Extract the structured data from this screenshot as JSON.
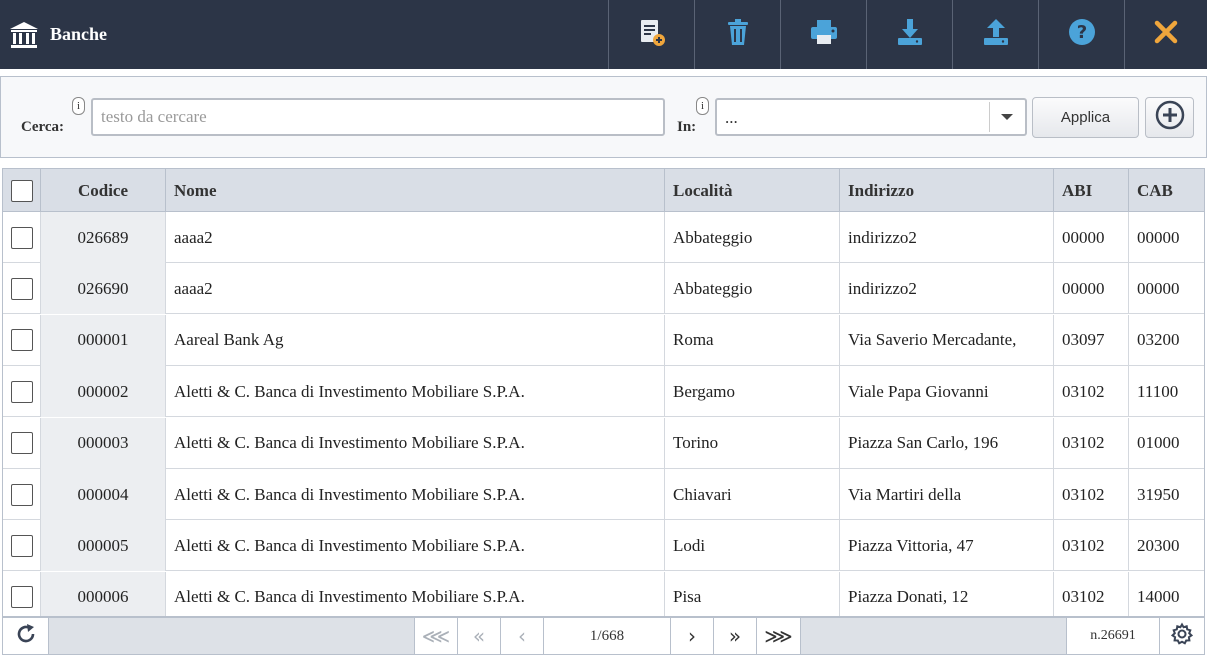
{
  "app": {
    "title": "Banche",
    "title_icon": "bank-icon"
  },
  "toolbar": {
    "buttons": [
      {
        "name": "new-document-button",
        "icon": "new-document-icon"
      },
      {
        "name": "delete-button",
        "icon": "trash-icon"
      },
      {
        "name": "print-button",
        "icon": "printer-icon"
      },
      {
        "name": "download-button",
        "icon": "download-icon"
      },
      {
        "name": "upload-button",
        "icon": "upload-icon"
      },
      {
        "name": "help-button",
        "icon": "help-icon"
      },
      {
        "name": "close-button",
        "icon": "close-icon"
      }
    ],
    "accent_color": "#f0a63c",
    "icon_color": "#4ba3d9",
    "header_bg": "#2c3547"
  },
  "search": {
    "label": "Cerca:",
    "info": "i",
    "placeholder": "testo da cercare",
    "value": "",
    "in_label": "In:",
    "in_info": "i",
    "in_value": "...",
    "apply_label": "Applica"
  },
  "table": {
    "columns": [
      "Codice",
      "Nome",
      "Località",
      "Indirizzo",
      "ABI",
      "CAB"
    ],
    "rows": [
      {
        "codice": "026689",
        "nome": "aaaa2",
        "localita": "Abbateggio",
        "indirizzo": "indirizzo2",
        "abi": "00000",
        "cab": "00000"
      },
      {
        "codice": "026690",
        "nome": "aaaa2",
        "localita": "Abbateggio",
        "indirizzo": "indirizzo2",
        "abi": "00000",
        "cab": "00000"
      },
      {
        "codice": "000001",
        "nome": "Aareal Bank Ag",
        "localita": "Roma",
        "indirizzo": "Via Saverio Mercadante,",
        "abi": "03097",
        "cab": "03200"
      },
      {
        "codice": "000002",
        "nome": "Aletti & C. Banca di Investimento Mobiliare S.P.A.",
        "localita": "Bergamo",
        "indirizzo": "Viale Papa Giovanni",
        "abi": "03102",
        "cab": "11100"
      },
      {
        "codice": "000003",
        "nome": "Aletti & C. Banca di Investimento Mobiliare S.P.A.",
        "localita": "Torino",
        "indirizzo": "Piazza San Carlo, 196",
        "abi": "03102",
        "cab": "01000"
      },
      {
        "codice": "000004",
        "nome": "Aletti & C. Banca di Investimento Mobiliare S.P.A.",
        "localita": "Chiavari",
        "indirizzo": "Via Martiri della",
        "abi": "03102",
        "cab": "31950"
      },
      {
        "codice": "000005",
        "nome": "Aletti & C. Banca di Investimento Mobiliare S.P.A.",
        "localita": "Lodi",
        "indirizzo": "Piazza Vittoria, 47",
        "abi": "03102",
        "cab": "20300"
      },
      {
        "codice": "000006",
        "nome": "Aletti & C. Banca di Investimento Mobiliare S.P.A.",
        "localita": "Pisa",
        "indirizzo": "Piazza Donati, 12",
        "abi": "03102",
        "cab": "14000"
      }
    ]
  },
  "pager": {
    "first": "⋘",
    "prev_page": "«",
    "prev": "‹",
    "page": "1/668",
    "next": "›",
    "next_page": "»",
    "last": "⋙",
    "count": "n.26691",
    "refresh_icon": "refresh-icon",
    "settings_icon": "gear-icon"
  }
}
